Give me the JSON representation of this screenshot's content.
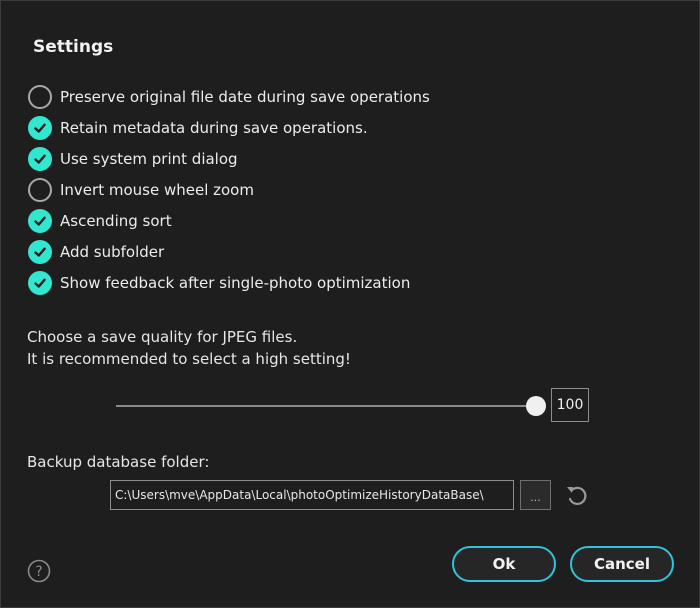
{
  "dialog": {
    "title": "Settings"
  },
  "options": [
    {
      "label": "Preserve original file date during save operations",
      "checked": false
    },
    {
      "label": "Retain metadata during save operations.",
      "checked": true
    },
    {
      "label": "Use system print dialog",
      "checked": true
    },
    {
      "label": "Invert mouse wheel zoom",
      "checked": false
    },
    {
      "label": "Ascending sort",
      "checked": true
    },
    {
      "label": "Add subfolder",
      "checked": true
    },
    {
      "label": "Show feedback after single-photo optimization",
      "checked": true
    }
  ],
  "jpeg": {
    "line1": "Choose a save quality for JPEG files.",
    "line2": "It is recommended to select a high setting!",
    "quality": 100,
    "quality_max": 100,
    "quality_label": "100"
  },
  "backup": {
    "label": "Backup database folder:",
    "path": "C:\\Users\\mve\\AppData\\Local\\photoOptimizeHistoryDataBase\\",
    "browse_label": "..."
  },
  "buttons": {
    "ok": "Ok",
    "cancel": "Cancel"
  },
  "colors": {
    "accent": "#31e7cf",
    "button_border": "#2fc4d8",
    "background": "#1e1e1e"
  },
  "icons": {
    "checked": "checkmark-icon",
    "reset": "undo-icon",
    "help": "help-icon"
  }
}
